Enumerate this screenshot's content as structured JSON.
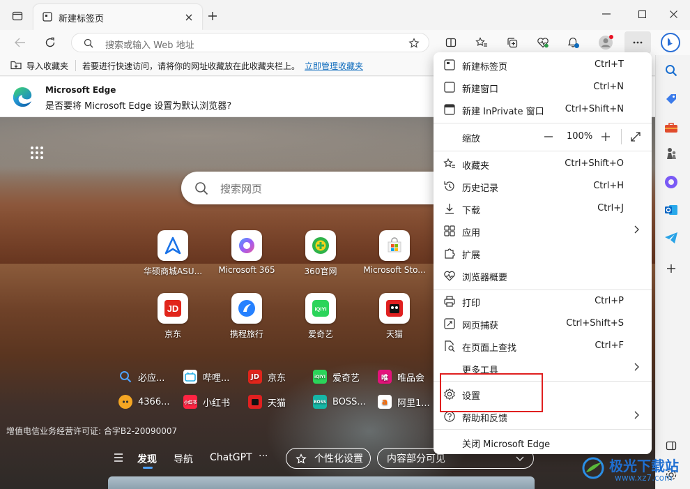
{
  "tab": {
    "title": "新建标签页"
  },
  "address": {
    "placeholder": "搜索或输入 Web 地址"
  },
  "favorites_bar": {
    "import_label": "导入收藏夹",
    "hint": "若要进行快速访问，请将你的网址收藏放在此收藏夹栏上。",
    "manage_link": "立即管理收藏夹"
  },
  "banner": {
    "title": "Microsoft Edge",
    "question": "是否要将 Microsoft Edge 设置为默认浏览器?"
  },
  "page_search": {
    "placeholder": "搜索网页"
  },
  "tiles": [
    {
      "label": "华硕商城ASU..."
    },
    {
      "label": "Microsoft 365"
    },
    {
      "label": "360官网"
    },
    {
      "label": "Microsoft Sto..."
    },
    {
      "label": "京东"
    },
    {
      "label": "携程旅行"
    },
    {
      "label": "爱奇艺"
    },
    {
      "label": "天猫"
    }
  ],
  "quick_links": [
    {
      "label": "必应..."
    },
    {
      "label": "哔哩..."
    },
    {
      "label": "京东"
    },
    {
      "label": "爱奇艺"
    },
    {
      "label": "唯品会"
    },
    {
      "label": "4366..."
    },
    {
      "label": "小红书"
    },
    {
      "label": "天猫"
    },
    {
      "label": "BOSS..."
    },
    {
      "label": "阿里1..."
    }
  ],
  "icp": "增值电信业务经营许可证: 合字B2-20090007",
  "bottom_nav": {
    "discover": "发现",
    "nav": "导航",
    "chatgpt": "ChatGPT",
    "more": "···",
    "personalize": "个性化设置",
    "content_visibility": "内容部分可见"
  },
  "menu": {
    "new_tab": {
      "label": "新建标签页",
      "shortcut": "Ctrl+T"
    },
    "new_window": {
      "label": "新建窗口",
      "shortcut": "Ctrl+N"
    },
    "new_inprivate": {
      "label": "新建 InPrivate 窗口",
      "shortcut": "Ctrl+Shift+N"
    },
    "zoom": {
      "label": "缩放",
      "value": "100%"
    },
    "favorites": {
      "label": "收藏夹",
      "shortcut": "Ctrl+Shift+O"
    },
    "history": {
      "label": "历史记录",
      "shortcut": "Ctrl+H"
    },
    "downloads": {
      "label": "下载",
      "shortcut": "Ctrl+J"
    },
    "apps": {
      "label": "应用"
    },
    "extensions": {
      "label": "扩展"
    },
    "browser_essentials": {
      "label": "浏览器概要"
    },
    "print": {
      "label": "打印",
      "shortcut": "Ctrl+P"
    },
    "web_capture": {
      "label": "网页捕获",
      "shortcut": "Ctrl+Shift+S"
    },
    "find": {
      "label": "在页面上查找",
      "shortcut": "Ctrl+F"
    },
    "more_tools": {
      "label": "更多工具"
    },
    "settings": {
      "label": "设置"
    },
    "help": {
      "label": "帮助和反馈"
    },
    "close": {
      "label": "关闭 Microsoft Edge"
    }
  },
  "watermark": {
    "text": "极光下载站",
    "url": "www.xz7.com"
  },
  "colors": {
    "accent": "#0f6cbd",
    "highlight": "#e02020",
    "chrome": "#f3f3f3"
  }
}
